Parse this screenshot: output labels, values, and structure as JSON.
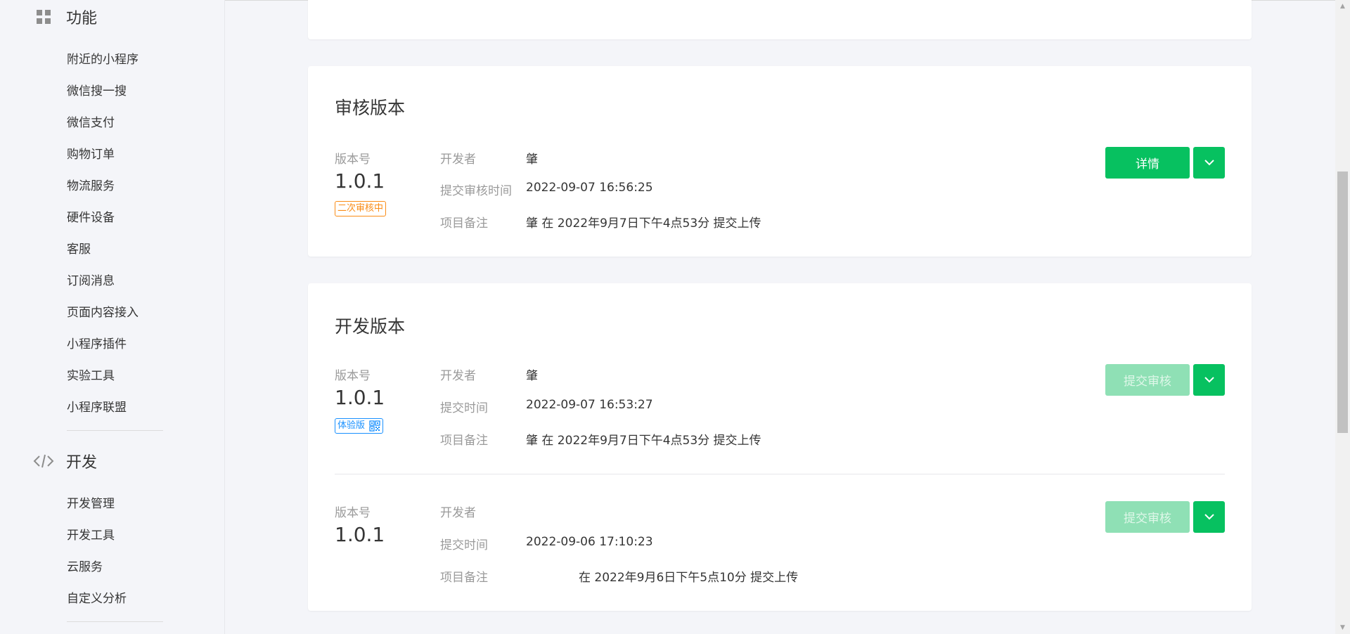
{
  "sidebar": {
    "function_section": {
      "title": "功能",
      "icon": "grid-icon",
      "items": [
        "附近的小程序",
        "微信搜一搜",
        "微信支付",
        "购物订单",
        "物流服务",
        "硬件设备",
        "客服",
        "订阅消息",
        "页面内容接入",
        "小程序插件",
        "实验工具",
        "小程序联盟"
      ]
    },
    "dev_section": {
      "title": "开发",
      "icon": "code-icon",
      "items": [
        "开发管理",
        "开发工具",
        "云服务",
        "自定义分析"
      ]
    }
  },
  "review_version": {
    "title": "审核版本",
    "version_label": "版本号",
    "version": "1.0.1",
    "status_tag": "二次审核中",
    "developer_label": "开发者",
    "developer": "肇",
    "time_label": "提交审核时间",
    "time": "2022-09-07 16:56:25",
    "note_label": "项目备注",
    "note": "肇 在 2022年9月7日下午4点53分 提交上传",
    "detail_button": "详情"
  },
  "dev_version": {
    "title": "开发版本",
    "entries": [
      {
        "version_label": "版本号",
        "version": "1.0.1",
        "tag": "体验版",
        "tag_icon": "qrcode-icon",
        "developer_label": "开发者",
        "developer": "肇",
        "time_label": "提交时间",
        "time": "2022-09-07 16:53:27",
        "note_label": "项目备注",
        "note": "肇 在 2022年9月7日下午4点53分 提交上传",
        "submit_button": "提交审核"
      },
      {
        "version_label": "版本号",
        "version": "1.0.1",
        "developer_label": "开发者",
        "developer": "",
        "time_label": "提交时间",
        "time": "2022-09-06 17:10:23",
        "note_label": "项目备注",
        "note": "在 2022年9月6日下午5点10分 提交上传",
        "submit_button": "提交审核"
      }
    ]
  },
  "colors": {
    "primary": "#07c160",
    "primary_disabled": "#8fe0b5",
    "tag_orange": "#fa8c16",
    "tag_blue": "#1890ff"
  }
}
